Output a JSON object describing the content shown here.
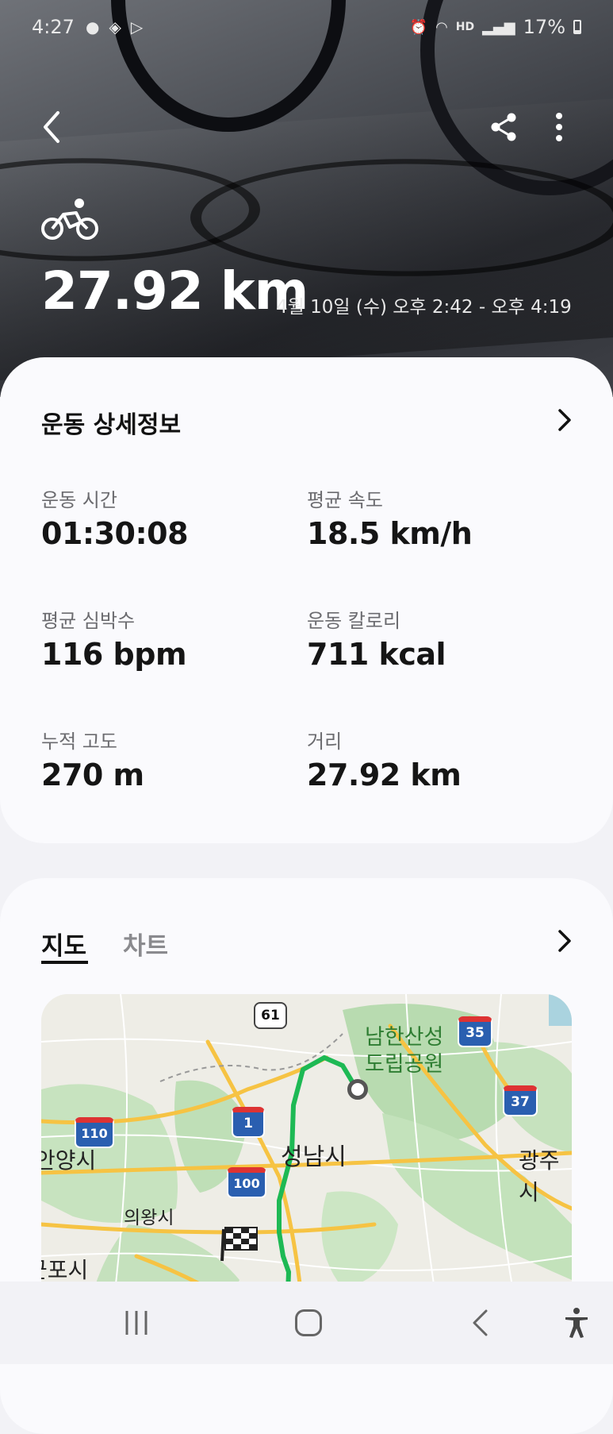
{
  "status_bar": {
    "time": "4:27",
    "battery": "17%",
    "hd_label": "HD"
  },
  "header": {
    "back_icon": "back-arrow-icon",
    "share_icon": "share-icon",
    "more_icon": "more-vertical-icon",
    "activity_icon": "cycling-icon",
    "distance": "27.92 km",
    "date_range": "4월 10일 (수) 오후 2:42 - 오후 4:19"
  },
  "details_card": {
    "title": "운동 상세정보",
    "stats": [
      {
        "label": "운동 시간",
        "value": "01:30:08"
      },
      {
        "label": "평균 속도",
        "value": "18.5 km/h"
      },
      {
        "label": "평균 심박수",
        "value": "116 bpm"
      },
      {
        "label": "운동 칼로리",
        "value": "711 kcal"
      },
      {
        "label": "누적 고도",
        "value": "270 m"
      },
      {
        "label": "거리",
        "value": "27.92 km"
      }
    ]
  },
  "map_card": {
    "tabs": [
      {
        "label": "지도",
        "selected": true
      },
      {
        "label": "차트",
        "selected": false
      }
    ],
    "map_labels": {
      "park": "남한산성\n도립공원",
      "seongnam": "성남시",
      "anyang": "안양시",
      "gwangju": "광주시",
      "uiwang": "의왕시",
      "gunpo": "군포시",
      "route_61": "61",
      "route_35": "35",
      "route_37": "37",
      "route_1": "1",
      "route_110": "110",
      "route_100": "100"
    },
    "route_color": "#1db954"
  },
  "nav_bar": {
    "recent_icon": "recent-apps-icon",
    "home_icon": "home-icon",
    "back_icon": "nav-back-icon",
    "accessibility_icon": "accessibility-icon"
  },
  "colors": {
    "card_bg": "#fafafd",
    "page_bg": "#f2f2f6",
    "accent_green": "#1db954"
  }
}
